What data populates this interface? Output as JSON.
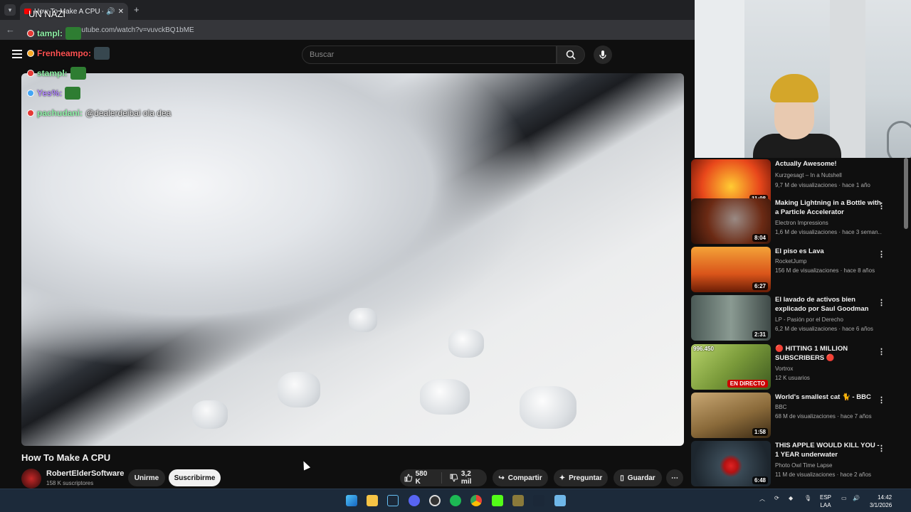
{
  "browser": {
    "tab_title": "How To Make A CPU - Y",
    "url": "youtube.com/watch?v=vuvckBQ1bME",
    "new_tab_icon": "plus-icon"
  },
  "youtube": {
    "search_placeholder": "Buscar"
  },
  "stream_overlay": {
    "top_text": "UN NAZI",
    "chat": [
      {
        "user": "tampl:",
        "msg": ""
      },
      {
        "user": "Frenheampo:",
        "msg": ""
      },
      {
        "user": "stampl:",
        "msg": ""
      },
      {
        "user": "Yes%:",
        "msg": ""
      },
      {
        "user": "pachudani:",
        "msg": "@dealerdeibai ola dea"
      }
    ]
  },
  "video": {
    "title": "How To Make A CPU",
    "channel": "RobertElderSoftware",
    "subscribers": "158 K suscriptores",
    "join_label": "Unirme",
    "subscribe_label": "Suscribirme",
    "likes": "580 K",
    "dislikes": "3,2 mil",
    "share_label": "Compartir",
    "ask_label": "Preguntar",
    "save_label": "Guardar"
  },
  "recommendations": [
    {
      "title": "Actually Awesome!",
      "channel": "Kurzgesagt – In a Nutshell",
      "meta": "9,7 M de visualizaciones · hace 1 año",
      "duration": "11:08",
      "color": "#e8471b"
    },
    {
      "title": "Making Lightning in a Bottle with a Particle Accelerator",
      "channel": "Electron Impressions",
      "meta": "1,6 M de visualizaciones · hace 3 seman...",
      "duration": "8:04",
      "color": "#6b2a14"
    },
    {
      "title": "El piso es Lava",
      "channel": "RocketJump",
      "meta": "156 M de visualizaciones · hace 8 años",
      "duration": "6:27",
      "color": "#d9541a"
    },
    {
      "title": "El lavado de activos bien explicado por Saul Goodman",
      "channel": "LP - Pasión por el Derecho",
      "meta": "6,2 M de visualizaciones · hace 6 años",
      "duration": "2:31",
      "color": "#5a6f6a"
    },
    {
      "title": "🔴 HITTING 1 MILLION SUBSCRIBERS 🔴",
      "channel": "Vortrox",
      "meta": "12 K usuarios",
      "viewers": "996.450",
      "live_label": "EN DIRECTO",
      "color": "#7a9a3a"
    },
    {
      "title": "World's smallest cat 🐈 - BBC",
      "channel": "BBC",
      "meta": "68 M de visualizaciones · hace 7 años",
      "duration": "1:58",
      "color": "#8a6a3a"
    },
    {
      "title": "THIS APPLE WOULD KILL YOU - 1 YEAR underwater",
      "channel": "Photo Owl Time Lapse",
      "meta": "11 M de visualizaciones · hace 2 años",
      "duration": "6:48",
      "color": "#2f3a44"
    }
  ],
  "taskbar": {
    "lang_top": "ESP",
    "lang_bottom": "LAA",
    "time": "14:42",
    "date": "3/1/2026"
  }
}
